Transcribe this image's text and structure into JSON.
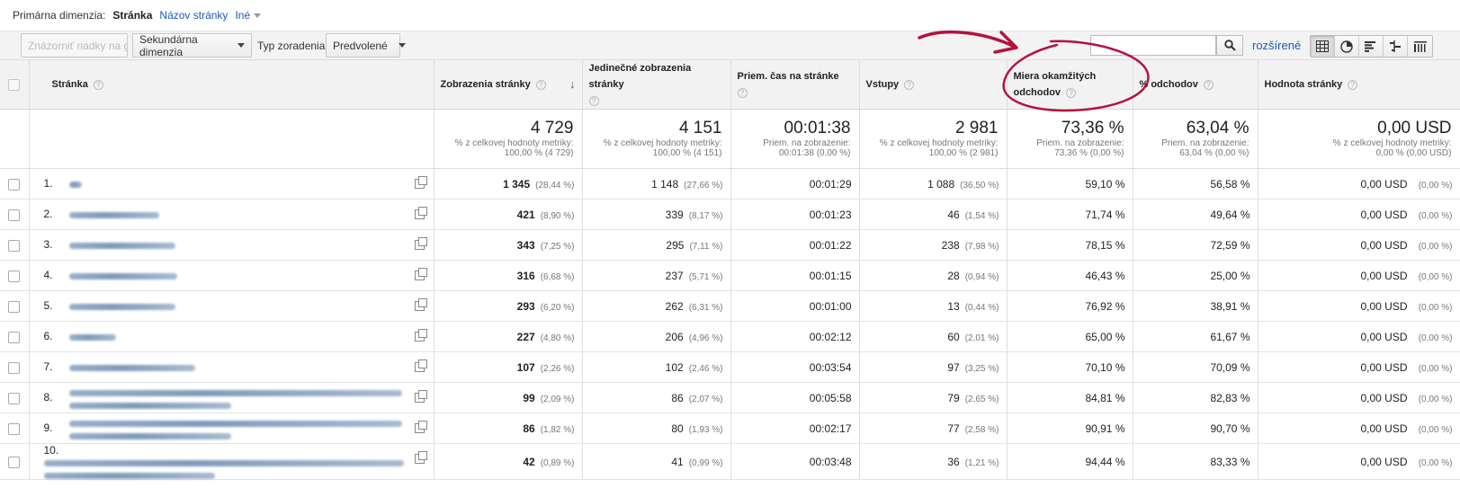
{
  "dimension": {
    "label": "Primárna dimenzia:",
    "active": "Stránka",
    "link": "Názov stránky",
    "other": "Iné"
  },
  "toolbar": {
    "plot_rows": "Znázorniť riadky na grafe",
    "secondary": "Sekundárna dimenzia",
    "sort_label": "Typ zoradenia:",
    "sort_value": "Predvolené",
    "search_placeholder": "",
    "advanced": "rozšírené"
  },
  "columns": {
    "page": "Stránka",
    "pageviews": "Zobrazenia stránky",
    "unique": "Jedinečné zobrazenia stránky",
    "avgtime": "Priem. čas na stránke",
    "entrances": "Vstupy",
    "bounce": "Miera okamžitých odchodov",
    "exit": "% odchodov",
    "value": "Hodnota stránky"
  },
  "totals": {
    "pageviews": {
      "big": "4 729",
      "sub1": "% z celkovej hodnoty metriky:",
      "sub2": "100,00 % (4 729)"
    },
    "unique": {
      "big": "4 151",
      "sub1": "% z celkovej hodnoty metriky:",
      "sub2": "100,00 % (4 151)"
    },
    "avgtime": {
      "big": "00:01:38",
      "sub1": "Priem. na zobrazenie:",
      "sub2": "00:01:38 (0,00 %)"
    },
    "entrances": {
      "big": "2 981",
      "sub1": "% z celkovej hodnoty metriky:",
      "sub2": "100,00 % (2 981)"
    },
    "bounce": {
      "big": "73,36 %",
      "sub1": "Priem. na zobrazenie:",
      "sub2": "73,36 % (0,00 %)"
    },
    "exit": {
      "big": "63,04 %",
      "sub1": "Priem. na zobrazenie:",
      "sub2": "63,04 % (0,00 %)"
    },
    "value": {
      "big": "0,00 USD",
      "sub1": "% z celkovej hodnoty metriky:",
      "sub2": "0,00 % (0,00 USD)"
    }
  },
  "rows": [
    {
      "idx": "1.",
      "pv": "1 345",
      "pvp": "(28,44 %)",
      "uq": "1 148",
      "uqp": "(27,66 %)",
      "time": "00:01:29",
      "en": "1 088",
      "enp": "(36,50 %)",
      "br": "59,10 %",
      "ex": "56,58 %",
      "val": "0,00 USD",
      "valp": "(0,00 %)"
    },
    {
      "idx": "2.",
      "pv": "421",
      "pvp": "(8,90 %)",
      "uq": "339",
      "uqp": "(8,17 %)",
      "time": "00:01:23",
      "en": "46",
      "enp": "(1,54 %)",
      "br": "71,74 %",
      "ex": "49,64 %",
      "val": "0,00 USD",
      "valp": "(0,00 %)"
    },
    {
      "idx": "3.",
      "pv": "343",
      "pvp": "(7,25 %)",
      "uq": "295",
      "uqp": "(7,11 %)",
      "time": "00:01:22",
      "en": "238",
      "enp": "(7,98 %)",
      "br": "78,15 %",
      "ex": "72,59 %",
      "val": "0,00 USD",
      "valp": "(0,00 %)"
    },
    {
      "idx": "4.",
      "pv": "316",
      "pvp": "(6,68 %)",
      "uq": "237",
      "uqp": "(5,71 %)",
      "time": "00:01:15",
      "en": "28",
      "enp": "(0,94 %)",
      "br": "46,43 %",
      "ex": "25,00 %",
      "val": "0,00 USD",
      "valp": "(0,00 %)"
    },
    {
      "idx": "5.",
      "pv": "293",
      "pvp": "(6,20 %)",
      "uq": "262",
      "uqp": "(6,31 %)",
      "time": "00:01:00",
      "en": "13",
      "enp": "(0,44 %)",
      "br": "76,92 %",
      "ex": "38,91 %",
      "val": "0,00 USD",
      "valp": "(0,00 %)"
    },
    {
      "idx": "6.",
      "pv": "227",
      "pvp": "(4,80 %)",
      "uq": "206",
      "uqp": "(4,96 %)",
      "time": "00:02:12",
      "en": "60",
      "enp": "(2,01 %)",
      "br": "65,00 %",
      "ex": "61,67 %",
      "val": "0,00 USD",
      "valp": "(0,00 %)"
    },
    {
      "idx": "7.",
      "pv": "107",
      "pvp": "(2,26 %)",
      "uq": "102",
      "uqp": "(2,46 %)",
      "time": "00:03:54",
      "en": "97",
      "enp": "(3,25 %)",
      "br": "70,10 %",
      "ex": "70,09 %",
      "val": "0,00 USD",
      "valp": "(0,00 %)"
    },
    {
      "idx": "8.",
      "pv": "99",
      "pvp": "(2,09 %)",
      "uq": "86",
      "uqp": "(2,07 %)",
      "time": "00:05:58",
      "en": "79",
      "enp": "(2,65 %)",
      "br": "84,81 %",
      "ex": "82,83 %",
      "val": "0,00 USD",
      "valp": "(0,00 %)"
    },
    {
      "idx": "9.",
      "pv": "86",
      "pvp": "(1,82 %)",
      "uq": "80",
      "uqp": "(1,93 %)",
      "time": "00:02:17",
      "en": "77",
      "enp": "(2,58 %)",
      "br": "90,91 %",
      "ex": "90,70 %",
      "val": "0,00 USD",
      "valp": "(0,00 %)"
    },
    {
      "idx": "10.",
      "pv": "42",
      "pvp": "(0,89 %)",
      "uq": "41",
      "uqp": "(0,99 %)",
      "time": "00:03:48",
      "en": "36",
      "enp": "(1,21 %)",
      "br": "94,44 %",
      "ex": "83,33 %",
      "val": "0,00 USD",
      "valp": "(0,00 %)"
    }
  ],
  "colors": {
    "link": "#1a5ab8",
    "annotation": "#b5123f",
    "header_bg": "#f2f2f2"
  },
  "annotation_icon": "hand-drawn-arrow-and-circle"
}
